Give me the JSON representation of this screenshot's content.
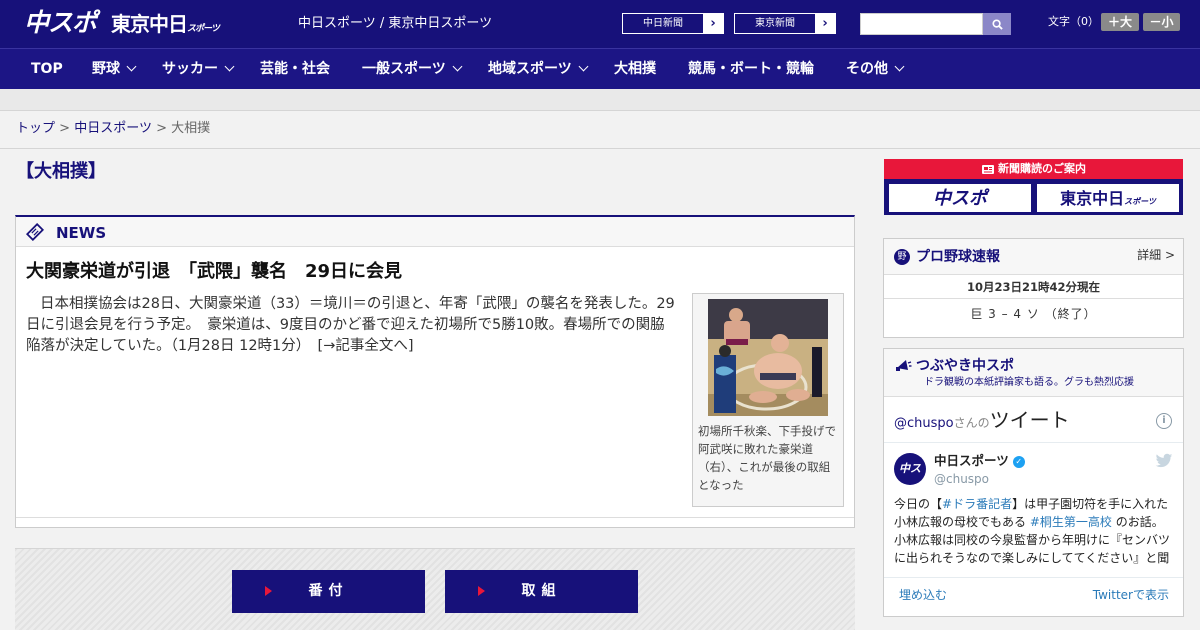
{
  "header": {
    "logo_chuspo": "中スポ",
    "logo_tokyo": "東京中日",
    "logo_tokyo_small": "スポーツ",
    "site_title": "中日スポーツ / 東京中日スポーツ",
    "ext_links": [
      {
        "label": "中日新聞",
        "arrow": "›"
      },
      {
        "label": "東京新聞",
        "arrow": "›"
      }
    ],
    "search_placeholder": "",
    "fontsize_label": "文字（0）",
    "font_larger": "＋大",
    "font_smaller": "－小"
  },
  "nav": [
    {
      "label": "TOP",
      "dropdown": false
    },
    {
      "label": "野球",
      "dropdown": true
    },
    {
      "label": "サッカー",
      "dropdown": true
    },
    {
      "label": "芸能・社会",
      "dropdown": false
    },
    {
      "label": "一般スポーツ",
      "dropdown": true
    },
    {
      "label": "地域スポーツ",
      "dropdown": true
    },
    {
      "label": "大相撲",
      "dropdown": false
    },
    {
      "label": "競馬・ボート・競輪",
      "dropdown": false
    },
    {
      "label": "その他",
      "dropdown": true
    }
  ],
  "breadcrumb": {
    "items": [
      "トップ",
      "中日スポーツ"
    ],
    "separator": ">",
    "current": "大相撲"
  },
  "page_title": "【大相撲】",
  "news": {
    "section_label": "NEWS",
    "title": "大関豪栄道が引退　「武隈」襲名　29日に会見",
    "body": "日本相撲協会は28日、大関豪栄道（33）＝境川＝の引退と、年寄「武隈」の襲名を発表した。29日に引退会見を行う予定。　豪栄道は、9度目のかど番で迎えた初場所で5勝10敗。春場所での関脇陥落が決定していた。（1月28日 12時1分）　",
    "read_more": "[→記事全文へ]",
    "photo_caption": "初場所千秋楽、下手投げで阿武咲に敗れた豪栄道（右）、これが最後の取組となった"
  },
  "buttons": {
    "banzuke": "番付",
    "torikumi": "取組"
  },
  "sidebar": {
    "subscription": {
      "title": "新聞購読のご案内",
      "logo1": "中スポ",
      "logo2": "東京中日",
      "logo2_small": "スポーツ"
    },
    "baseball": {
      "icon": "野",
      "title": "プロ野球速報",
      "detail": "詳細 >",
      "time": "10月23日21時42分現在",
      "score": "巨 3 – 4 ソ （終了）"
    },
    "twitter": {
      "title": "つぶやき中スポ",
      "subtitle": "ドラ観戦の本紙評論家も語る。グラも熱烈応援",
      "header_handle": "@chuspo",
      "header_suffix": "さんの",
      "header_big": "ツイート",
      "info_glyph": "i",
      "account_name": "中日スポーツ",
      "verified_glyph": "✓",
      "account_handle": "@chuspo",
      "avatar_text": "中スポ",
      "tweet_parts": [
        {
          "t": "今日の【",
          "tag": false
        },
        {
          "t": "#ドラ番記者",
          "tag": true
        },
        {
          "t": "】は甲子園切符を手に入れた小林広報の母校でもある ",
          "tag": false
        },
        {
          "t": "#桐生第一高校",
          "tag": true
        },
        {
          "t": " のお話。小林広報は同校の今泉監督から年明けに『センバツに出られそうなので楽しみにしててください』と聞い",
          "tag": false
        }
      ],
      "embed": "埋め込む",
      "view_on_twitter": "Twitterで表示"
    }
  }
}
